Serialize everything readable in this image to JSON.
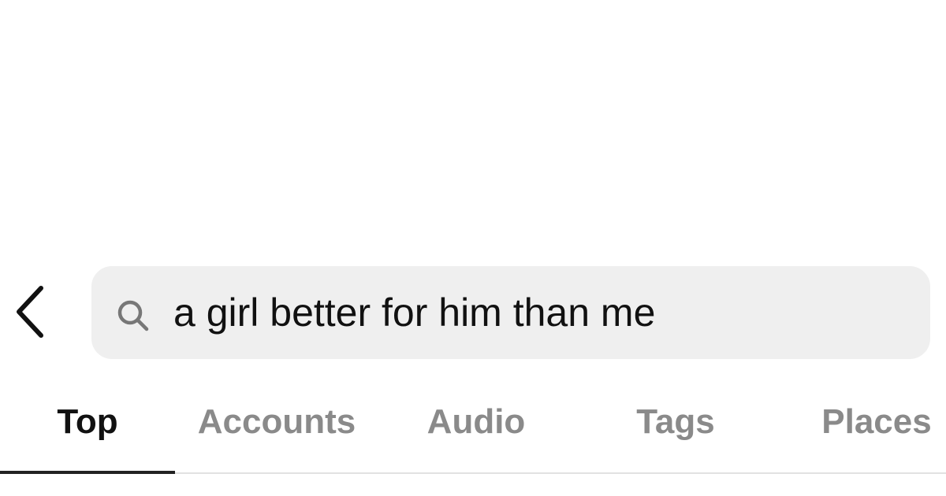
{
  "header": {
    "back_icon": "chevron-left-icon"
  },
  "search": {
    "icon": "search-icon",
    "value": "a girl better for him than me",
    "background_color": "#efefef"
  },
  "tabs": [
    {
      "label": "Top",
      "active": true
    },
    {
      "label": "Accounts",
      "active": false
    },
    {
      "label": "Audio",
      "active": false
    },
    {
      "label": "Tags",
      "active": false
    },
    {
      "label": "Places",
      "active": false
    }
  ],
  "colors": {
    "active_tab": "#111111",
    "inactive_tab": "#8a8a8a",
    "indicator": "#222222"
  }
}
